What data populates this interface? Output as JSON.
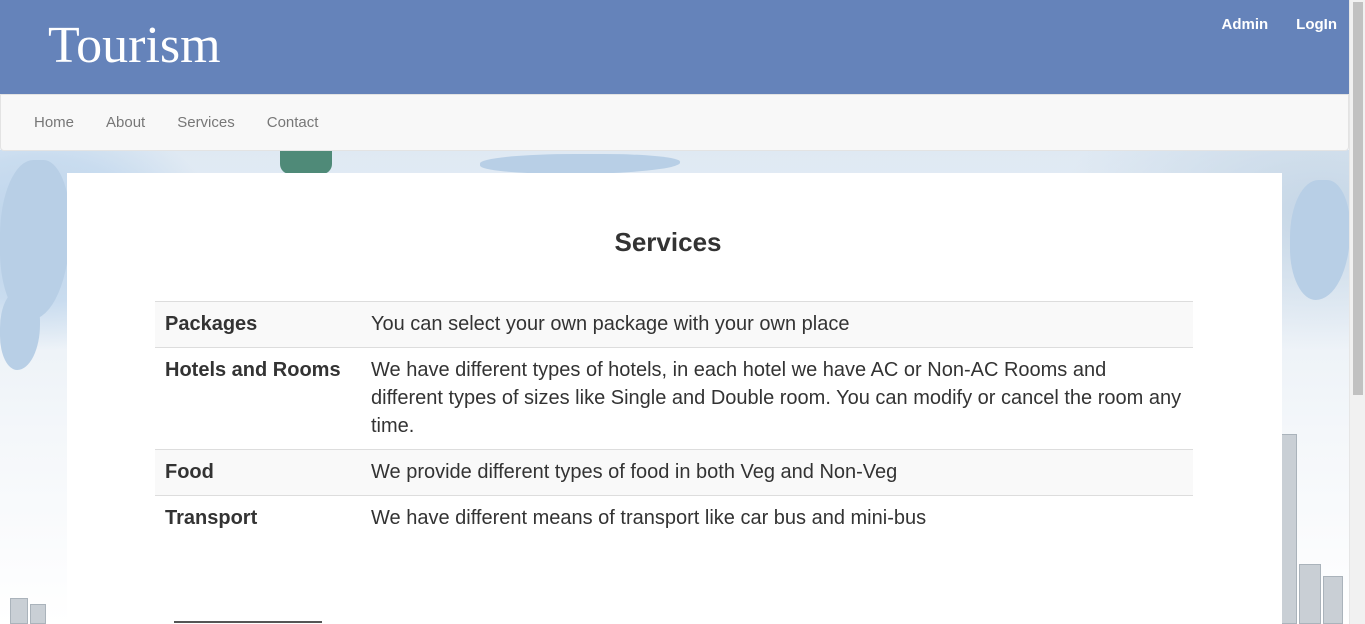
{
  "header": {
    "brand": "Tourism",
    "links": [
      "Admin",
      "LogIn"
    ],
    "background_color": "#6583ba"
  },
  "navbar": {
    "items": [
      "Home",
      "About",
      "Services",
      "Contact"
    ]
  },
  "main": {
    "title": "Services",
    "services": [
      {
        "name": "Packages",
        "description": "You can select your own package with your own place"
      },
      {
        "name": "Hotels and Rooms",
        "description": "We have different types of hotels, in each hotel we have AC or Non-AC Rooms and different types of sizes like Single and Double room. You can modify or cancel the room any time."
      },
      {
        "name": "Food",
        "description": "We provide different types of food in both Veg and Non-Veg"
      },
      {
        "name": "Transport",
        "description": "We have different means of transport like car bus and mini-bus"
      }
    ]
  }
}
